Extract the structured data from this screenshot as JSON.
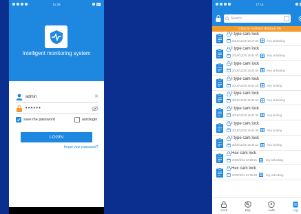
{
  "login_screen": {
    "status": {
      "time": "11:29",
      "battery": "82"
    },
    "app_title": "Intelligent monitoring system",
    "username_value": "admin",
    "password_value": "••••••",
    "save_password_label": "save the password",
    "save_password_checked": true,
    "autologin_label": "autologin",
    "autologin_checked": false,
    "login_label": "LOGIN",
    "forgot_label": "forget your password?"
  },
  "records_screen": {
    "status": {
      "time": "17:14",
      "battery": "82"
    },
    "search_placeholder": "Search",
    "banner_text": "Click to conform devices (4)",
    "records": [
      {
        "title": "I type cam lock",
        "time": "2019/12/26 16:17:29",
        "type": "key unlocking"
      },
      {
        "title": "I type cam lock",
        "time": "2019/12/26 16:44:55",
        "type": "key unlocking"
      },
      {
        "title": "I type cam lock",
        "time": "2019/12/26 16:44:55",
        "type": "key unlocking"
      },
      {
        "title": "I type cam lock",
        "time": "2019/12/26 16:44:16",
        "type": "key locking"
      },
      {
        "title": "I type cam lock",
        "time": "2019/12/26 16:44:53",
        "type": "key unlocking"
      },
      {
        "title": "I type cam lock",
        "time": "2019/12/26 16:44:30",
        "type": "key locking"
      },
      {
        "title": "I type cam lock",
        "time": "2019/12/26 16:44:36",
        "type": "key locking"
      },
      {
        "title": "I type cam lock",
        "time": "2019/12/26 16:44:12",
        "type": "key locking"
      },
      {
        "title": "Hex cam lock",
        "time": "2020/3/12 12:58:21",
        "type": "key unlocking"
      },
      {
        "title": "Hex cam lock",
        "time": "2020/3/12 12:35:48",
        "type": "key unlocking"
      }
    ],
    "tabs": [
      {
        "label": "Lock",
        "icon": "lock-icon",
        "active": false
      },
      {
        "label": "Key",
        "icon": "key-icon",
        "active": false
      },
      {
        "label": "Auth",
        "icon": "auth-icon",
        "active": false
      },
      {
        "label": "Log",
        "icon": "log-icon",
        "active": true
      }
    ]
  },
  "colors": {
    "accent": "#1e87e0",
    "banner": "#f39a2d",
    "background": "#0b2f8f"
  }
}
